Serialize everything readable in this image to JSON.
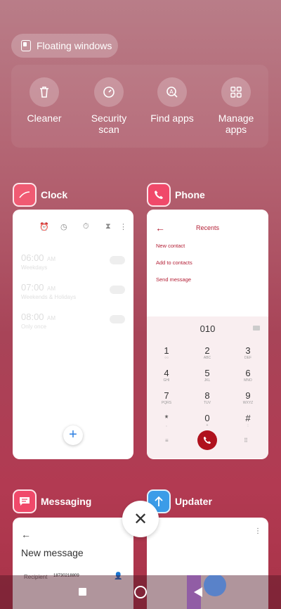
{
  "floating": {
    "label": "Floating windows"
  },
  "quick_actions": [
    {
      "label": "Cleaner",
      "icon": "trash-icon"
    },
    {
      "label": "Security\nscan",
      "icon": "security-icon"
    },
    {
      "label": "Find apps",
      "icon": "find-apps-icon"
    },
    {
      "label": "Manage\napps",
      "icon": "grid-icon"
    }
  ],
  "cards": {
    "clock": {
      "name": "Clock",
      "alarms": [
        {
          "time": "06:00",
          "ampm": "AM",
          "sub": "Weekdays"
        },
        {
          "time": "07:00",
          "ampm": "AM",
          "sub": "Weekends & Holidays"
        },
        {
          "time": "08:00",
          "ampm": "AM",
          "sub": "Only once"
        }
      ],
      "fab": "+"
    },
    "phone": {
      "name": "Phone",
      "title": "Recents",
      "links": [
        "New contact",
        "Add to contacts",
        "Send message"
      ],
      "dial_number": "010",
      "keys": [
        {
          "d": "1",
          "l": "○○"
        },
        {
          "d": "2",
          "l": "ABC"
        },
        {
          "d": "3",
          "l": "DEF"
        },
        {
          "d": "4",
          "l": "GHI"
        },
        {
          "d": "5",
          "l": "JKL"
        },
        {
          "d": "6",
          "l": "MNO"
        },
        {
          "d": "7",
          "l": "PQRS"
        },
        {
          "d": "8",
          "l": "TUV"
        },
        {
          "d": "9",
          "l": "WXYZ"
        },
        {
          "d": "*",
          "l": ","
        },
        {
          "d": "0",
          "l": "+"
        },
        {
          "d": "#",
          "l": ";"
        }
      ]
    },
    "messaging": {
      "name": "Messaging",
      "title": "New message",
      "recipient_label": "Recipient",
      "recipient_number": "18730218809"
    },
    "updater": {
      "name": "Updater"
    }
  },
  "colors": {
    "clock_icon": "#f05b73",
    "phone_icon": "#f0496a",
    "messaging_icon": "#f0496a",
    "updater_icon": "#3b9ce8",
    "accent_red": "#b31e34"
  }
}
